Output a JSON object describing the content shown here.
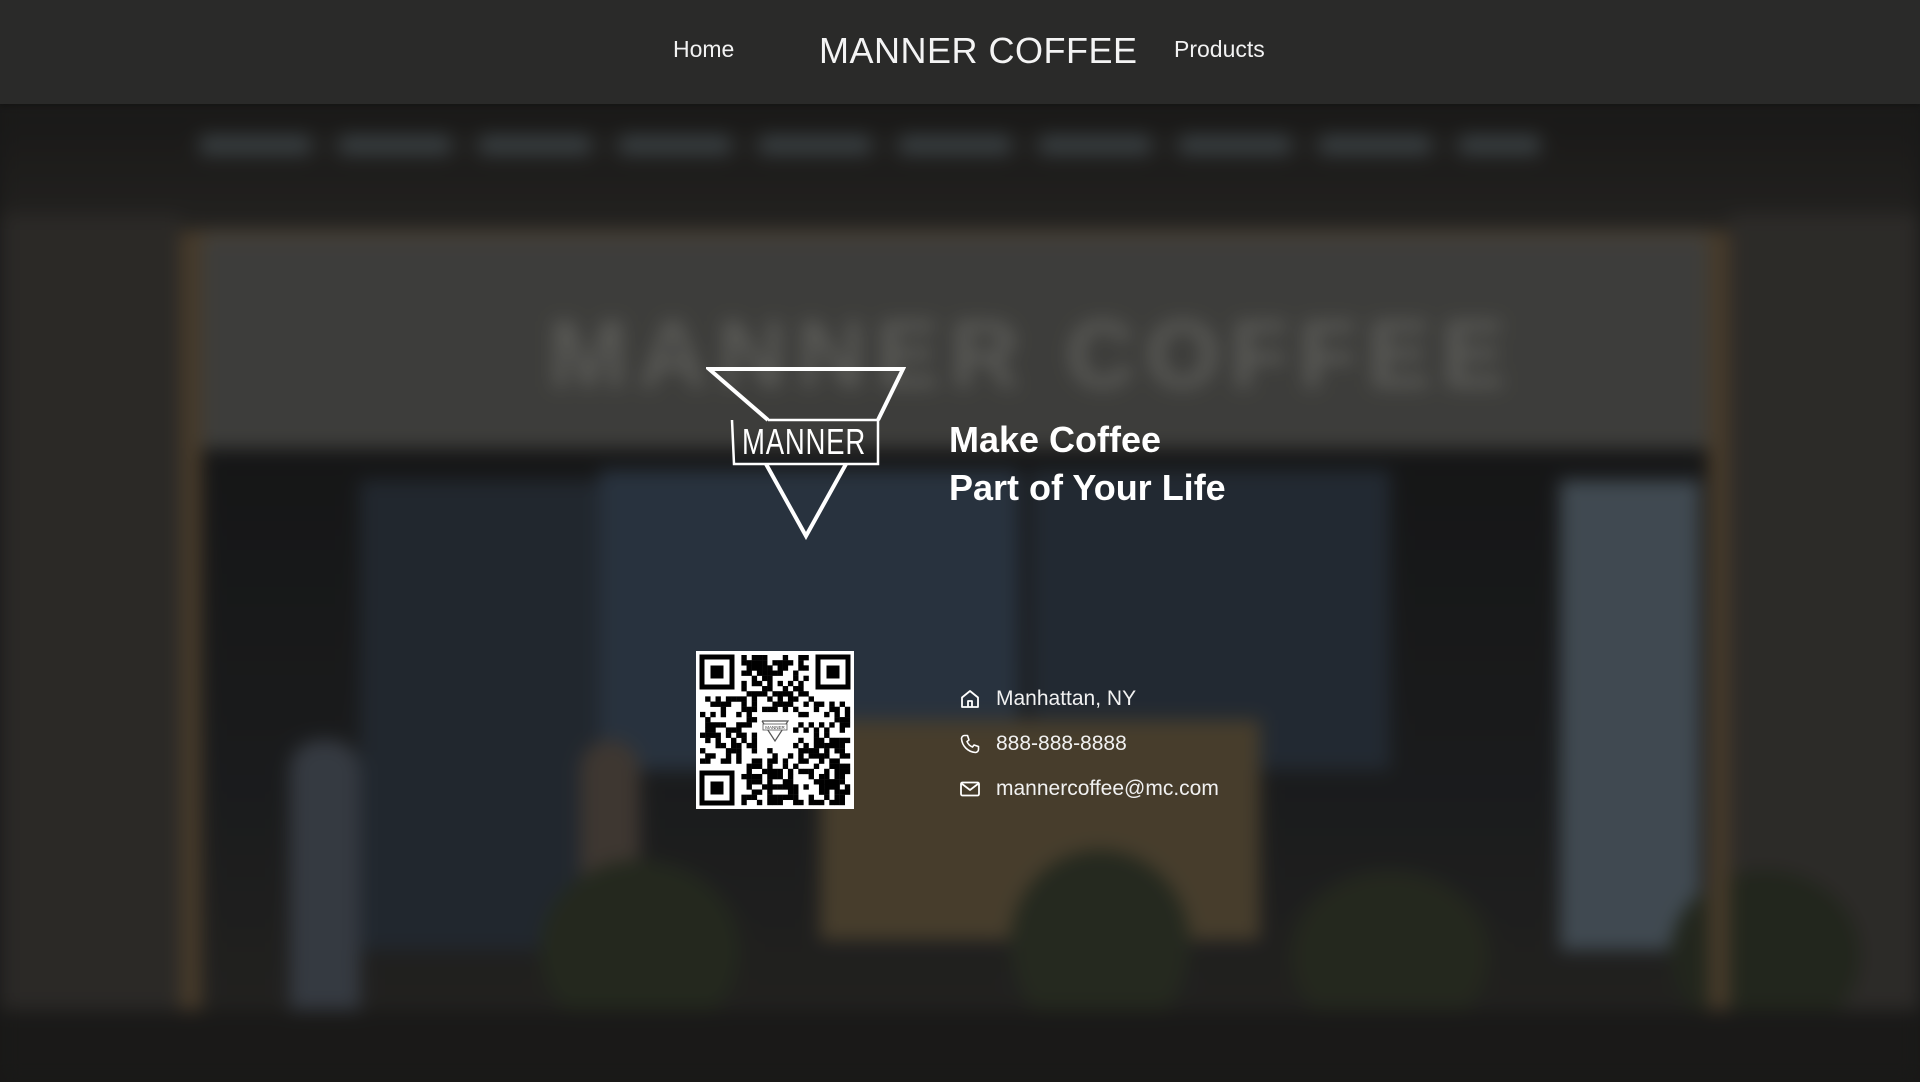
{
  "nav": {
    "home_label": "Home",
    "brand": "MANNER COFFEE",
    "products_label": "Products"
  },
  "background": {
    "sign_text": "MANNER COFFEE"
  },
  "hero": {
    "logo_text": "MANNER",
    "tagline_line1": "Make Coffee",
    "tagline_line2": "Part of Your Life"
  },
  "qr": {
    "center_logo_text": "MANNER"
  },
  "contact": {
    "items": [
      {
        "icon": "home-icon",
        "text": "Manhattan, NY"
      },
      {
        "icon": "phone-icon",
        "text": "888-888-8888"
      },
      {
        "icon": "mail-icon",
        "text": "mannercoffee@mc.com"
      }
    ]
  },
  "colors": {
    "navbar_bg": "#2a2a29",
    "text": "#ffffff"
  }
}
